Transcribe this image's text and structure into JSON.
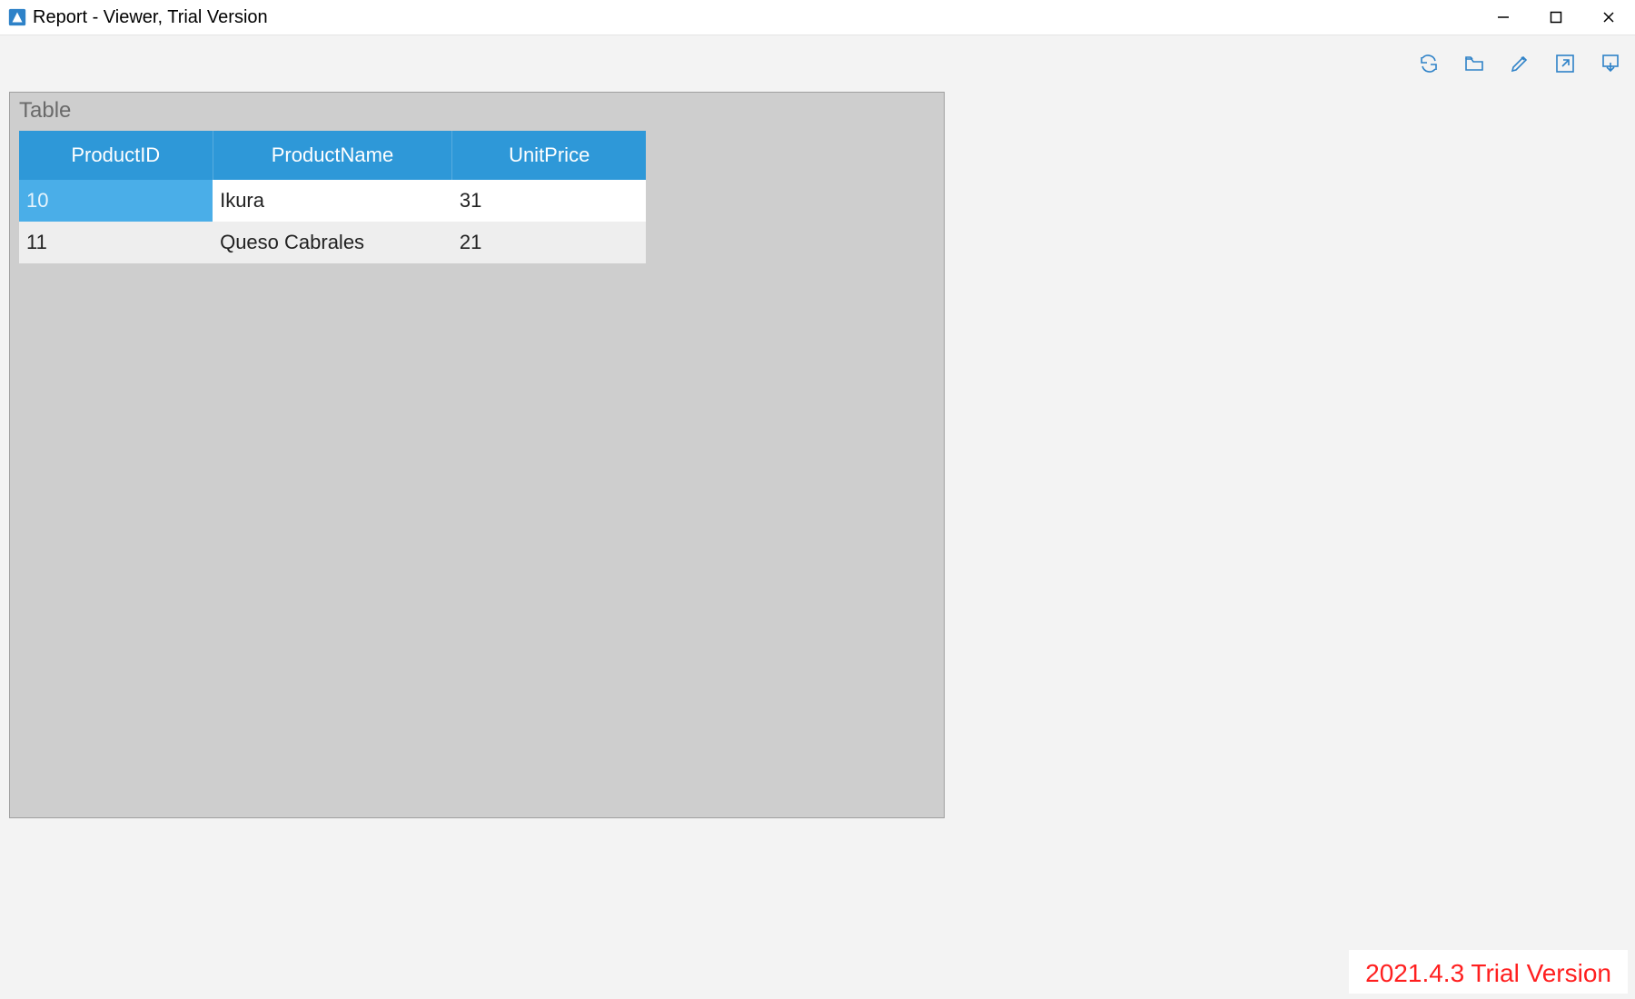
{
  "window": {
    "title": "Report - Viewer, Trial Version"
  },
  "panel": {
    "title": "Table"
  },
  "table": {
    "columns": [
      "ProductID",
      "ProductName",
      "UnitPrice"
    ],
    "rows": [
      {
        "ProductID": "10",
        "ProductName": "Ikura",
        "UnitPrice": "31",
        "selected": true
      },
      {
        "ProductID": "11",
        "ProductName": "Queso Cabrales",
        "UnitPrice": "21",
        "selected": false
      }
    ]
  },
  "trial": {
    "watermark": "2021.4.3 Trial Version"
  },
  "toolbar_icons": [
    "refresh-icon",
    "open-icon",
    "edit-icon",
    "export-icon",
    "download-icon"
  ],
  "colors": {
    "header_blue": "#2e98d8",
    "icon_blue": "#2e82c8",
    "trial_red": "#ff1f1f"
  },
  "chart_data": {
    "type": "table",
    "columns": [
      "ProductID",
      "ProductName",
      "UnitPrice"
    ],
    "rows": [
      [
        "10",
        "Ikura",
        "31"
      ],
      [
        "11",
        "Queso Cabrales",
        "21"
      ]
    ]
  }
}
